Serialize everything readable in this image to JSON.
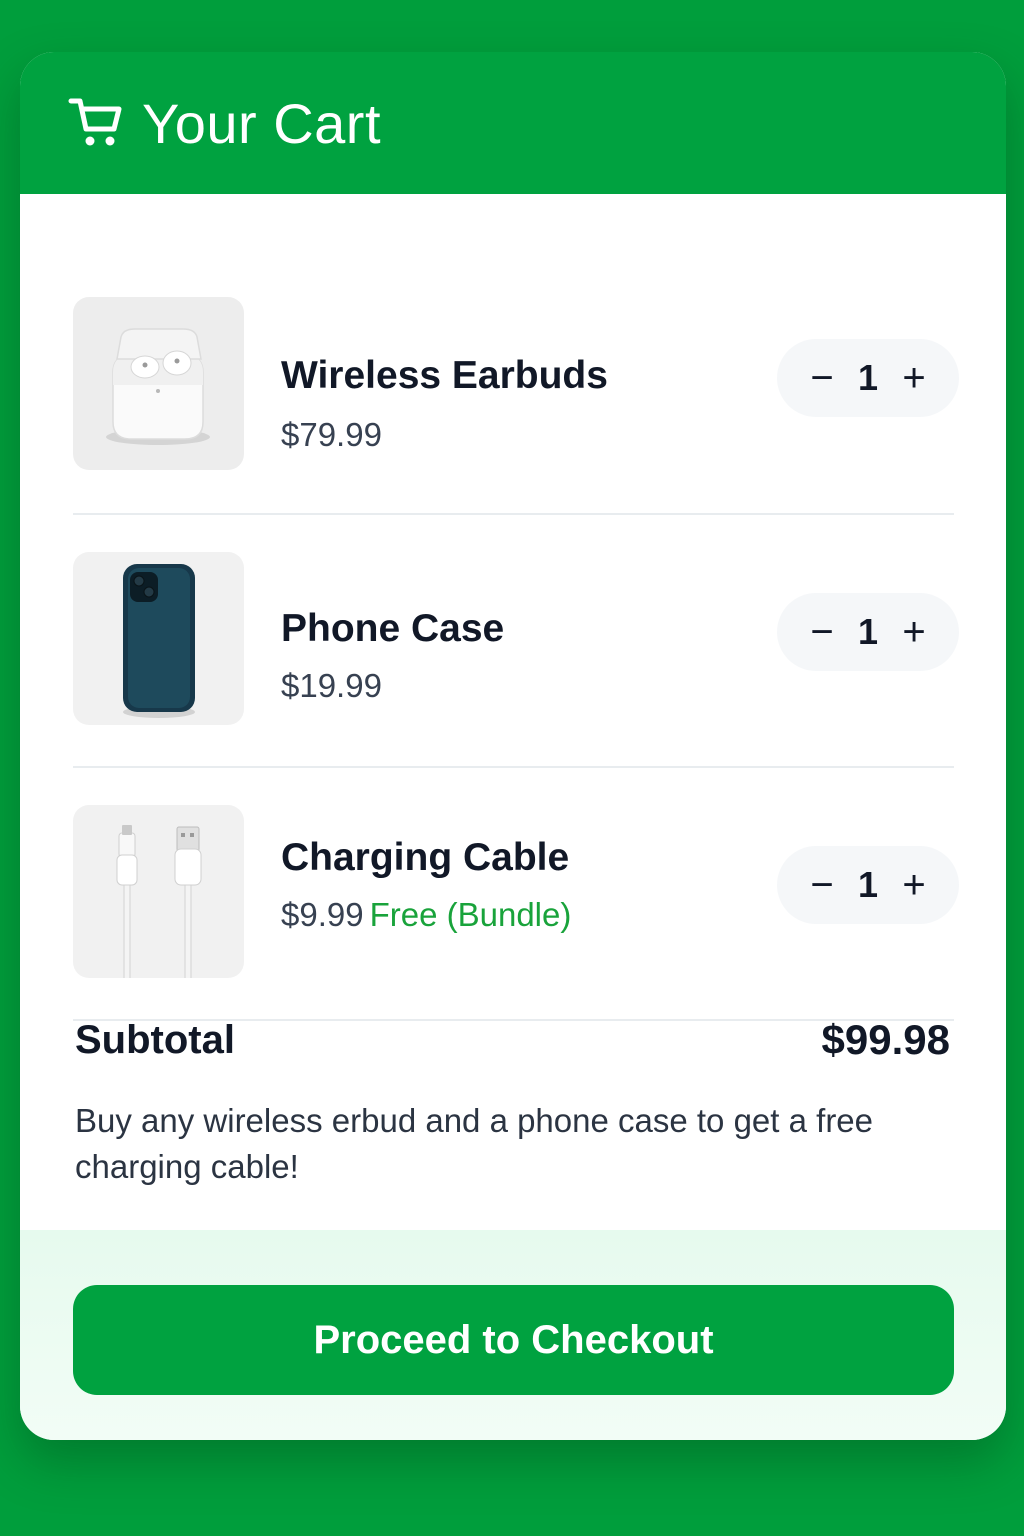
{
  "header": {
    "title": "Your Cart",
    "icon": "shopping-cart-icon"
  },
  "items": [
    {
      "name": "Wireless Earbuds",
      "price": "$79.99",
      "promo": "",
      "qty": "1",
      "minus": "−",
      "plus": "+",
      "image": "earbuds-image"
    },
    {
      "name": "Phone Case",
      "price": "$19.99",
      "promo": "",
      "qty": "1",
      "minus": "−",
      "plus": "+",
      "image": "phone-case-image"
    },
    {
      "name": "Charging Cable",
      "price": "$9.99",
      "promo": "Free (Bundle)",
      "qty": "1",
      "minus": "−",
      "plus": "+",
      "image": "charging-cable-image"
    }
  ],
  "summary": {
    "subtotal_label": "Subtotal",
    "subtotal_value": "$99.98",
    "promo_text": "Buy any wireless erbud and a phone case to get a free charging cable!"
  },
  "checkout": {
    "label": "Proceed to Checkout"
  },
  "colors": {
    "brand_green": "#00a240",
    "promo_green": "#19a33b",
    "background": "#009e3c"
  }
}
